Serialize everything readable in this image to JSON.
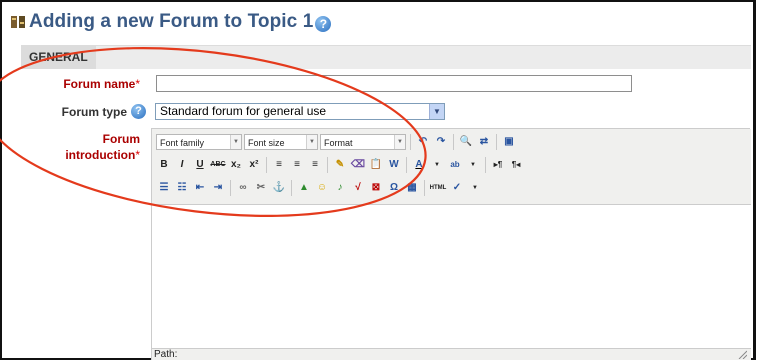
{
  "page": {
    "title": "Adding a new Forum to Topic 1",
    "icons": {
      "title_icon": "forum-icon",
      "help": "help-icon"
    }
  },
  "section": {
    "label": "GENERAL"
  },
  "fields": {
    "forum_name": {
      "label": "Forum name",
      "required_mark": "*",
      "value": ""
    },
    "forum_type": {
      "label": "Forum type",
      "selected": "Standard forum for general use"
    },
    "forum_intro": {
      "label_line1": "Forum",
      "label_line2": "introduction",
      "required_mark": "*"
    }
  },
  "editor": {
    "font_family": "Font family",
    "font_size": "Font size",
    "format": "Format",
    "path_label": "Path:",
    "row2_buttons": [
      "B",
      "I",
      "U",
      "ABC",
      "x₂",
      "x²"
    ],
    "row3_icons": [
      "bullet-list-icon",
      "numbered-list-icon",
      "outdent-icon",
      "indent-icon",
      "link-icon",
      "unlink-icon",
      "anchor-icon"
    ]
  },
  "colors": {
    "title": "#3a5a85",
    "required_label": "#aa0000",
    "annotation": "#e43a1c"
  }
}
